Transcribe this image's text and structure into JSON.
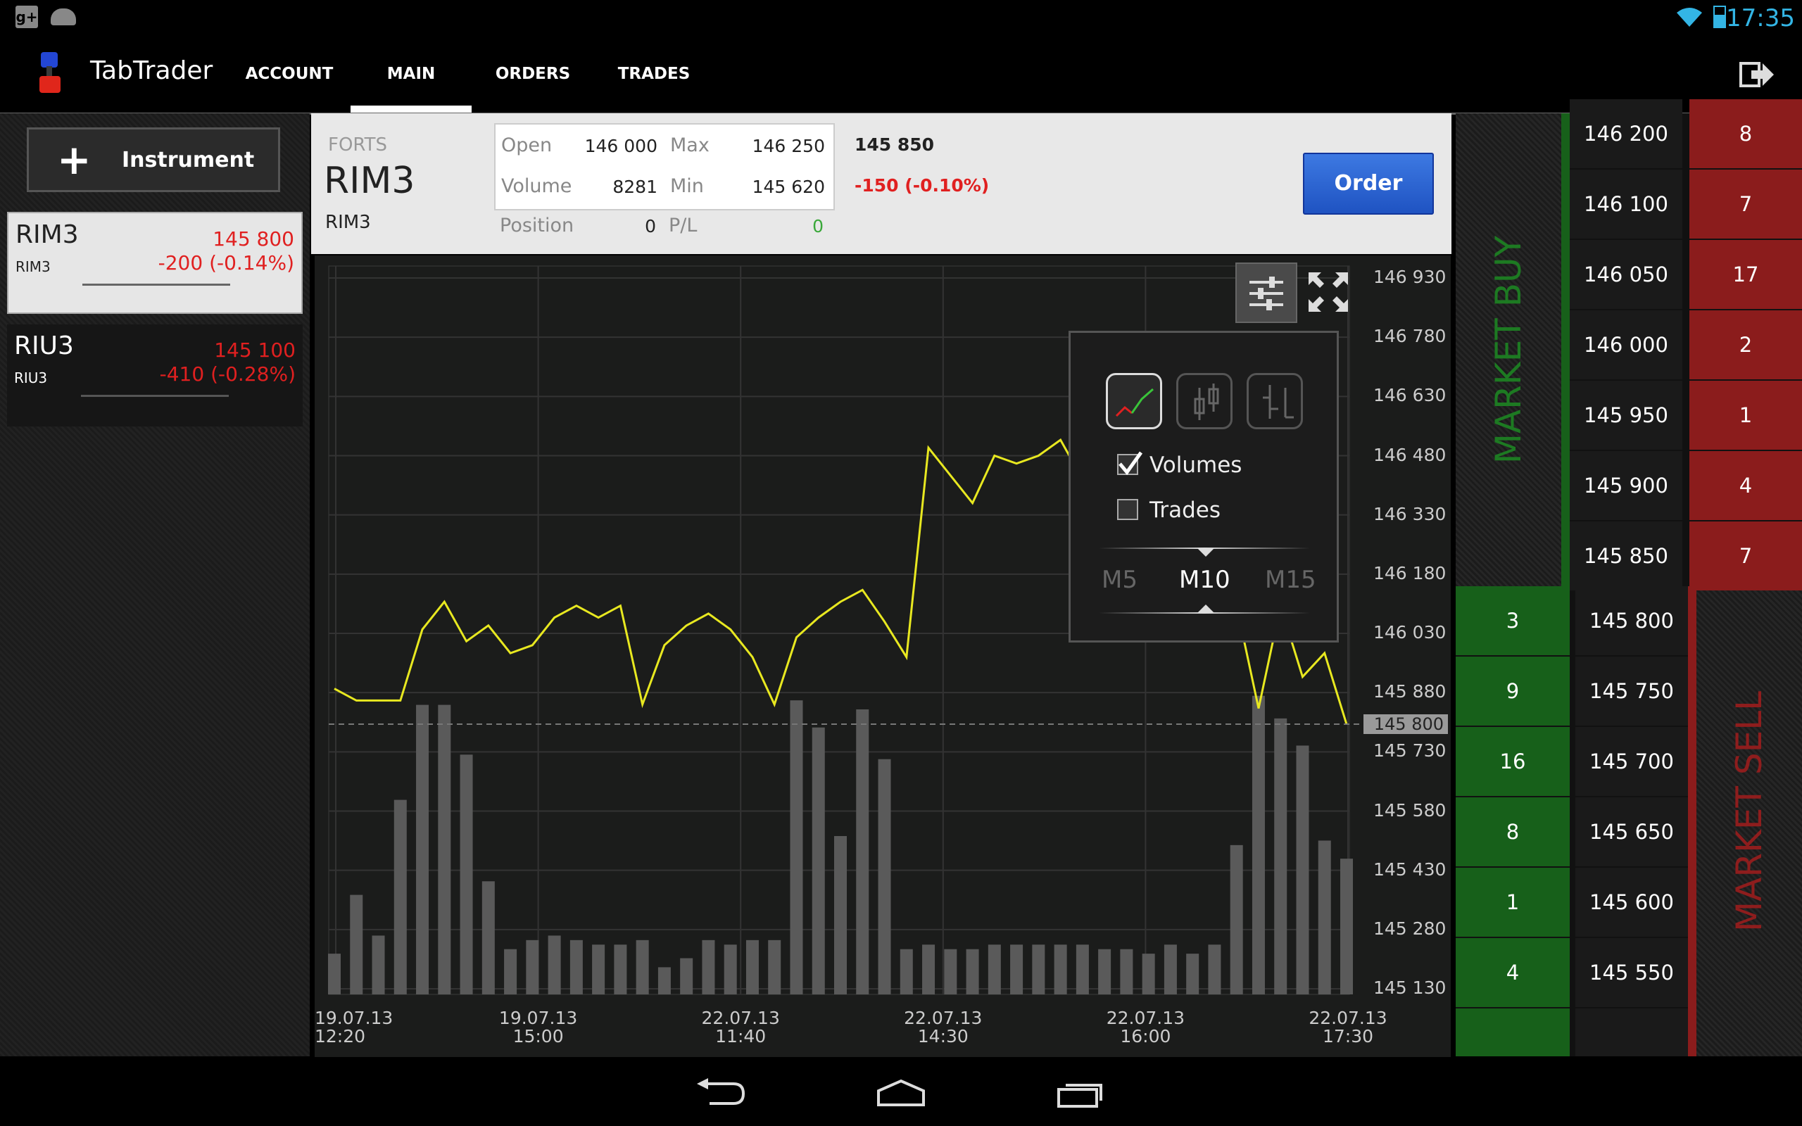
{
  "app": {
    "title": "TabTrader",
    "time": "17:35"
  },
  "tabs": [
    {
      "label": "ACCOUNT",
      "active": false
    },
    {
      "label": "MAIN",
      "active": true
    },
    {
      "label": "ORDERS",
      "active": false
    },
    {
      "label": "TRADES",
      "active": false
    }
  ],
  "sidebar": {
    "add_label": "Instrument",
    "instruments": [
      {
        "name": "RIM3",
        "sub": "RIM3",
        "price": "145 800",
        "change": "-200 (-0.14%)",
        "selected": true
      },
      {
        "name": "RIU3",
        "sub": "RIU3",
        "price": "145 100",
        "change": "-410 (-0.28%)",
        "selected": false
      }
    ]
  },
  "header": {
    "exchange": "FORTS",
    "symbol": "RIM3",
    "subsymbol": "RIM3",
    "stats": {
      "open_label": "Open",
      "open": "146 000",
      "max_label": "Max",
      "max": "146 250",
      "volume_label": "Volume",
      "volume": "8281",
      "min_label": "Min",
      "min": "145 620",
      "position_label": "Position",
      "position": "0",
      "pl_label": "P/L",
      "pl": "0"
    },
    "last_price": "145 850",
    "last_change": "-150 (-0.10%)",
    "order_label": "Order"
  },
  "chart_data": {
    "type": "line",
    "series": [
      {
        "values": [
          145890,
          145860,
          145860,
          145860,
          146040,
          146110,
          146010,
          146050,
          145980,
          146000,
          146070,
          146100,
          146070,
          146100,
          145850,
          146000,
          146050,
          146080,
          146040,
          145970,
          145850,
          146020,
          146070,
          146110,
          146140,
          146060,
          145970,
          146500,
          146430,
          146360,
          146480,
          146460,
          146480,
          146520,
          146420,
          146380,
          146520,
          146540,
          146490,
          146470,
          146430,
          146100,
          145840,
          146100,
          145920,
          145980,
          145800
        ]
      }
    ],
    "volume": [
      9,
      22,
      13,
      43,
      64,
      64,
      53,
      25,
      10,
      12,
      13,
      12,
      11,
      11,
      12,
      6,
      8,
      12,
      11,
      12,
      12,
      65,
      59,
      35,
      63,
      52,
      10,
      11,
      10,
      10,
      11,
      11,
      11,
      11,
      11,
      10,
      10,
      9,
      11,
      9,
      11,
      33,
      66,
      61,
      55,
      34,
      30
    ],
    "yticks": [
      "146 930",
      "146 780",
      "146 630",
      "146 480",
      "146 330",
      "146 180",
      "146 030",
      "145 880",
      "145 730",
      "145 580",
      "145 430",
      "145 280",
      "145 130"
    ],
    "xticks": [
      {
        "date": "19.07.13",
        "time": "12:20"
      },
      {
        "date": "19.07.13",
        "time": "15:00"
      },
      {
        "date": "22.07.13",
        "time": "11:40"
      },
      {
        "date": "22.07.13",
        "time": "14:30"
      },
      {
        "date": "22.07.13",
        "time": "16:00"
      },
      {
        "date": "22.07.13",
        "time": "17:30"
      }
    ],
    "ylim": [
      145130,
      146930
    ],
    "current_marker": "145 800",
    "line_color": "#e8e820",
    "bar_color": "#5a5a5a"
  },
  "popup": {
    "volumes_label": "Volumes",
    "volumes_checked": true,
    "trades_label": "Trades",
    "trades_checked": false,
    "intervals": [
      "M5",
      "M10",
      "M15"
    ],
    "selected_interval": "M10"
  },
  "orderbook": {
    "market_buy_label": "MARKET BUY",
    "market_sell_label": "MARKET SELL",
    "asks": [
      {
        "price": "146 200",
        "qty": "8"
      },
      {
        "price": "146 100",
        "qty": "7"
      },
      {
        "price": "146 050",
        "qty": "17"
      },
      {
        "price": "146 000",
        "qty": "2"
      },
      {
        "price": "145 950",
        "qty": "1"
      },
      {
        "price": "145 900",
        "qty": "4"
      },
      {
        "price": "145 850",
        "qty": "7"
      }
    ],
    "bids": [
      {
        "price": "145 800",
        "qty": "3"
      },
      {
        "price": "145 750",
        "qty": "9"
      },
      {
        "price": "145 700",
        "qty": "16"
      },
      {
        "price": "145 650",
        "qty": "8"
      },
      {
        "price": "145 600",
        "qty": "1"
      },
      {
        "price": "145 550",
        "qty": "4"
      }
    ],
    "buy_color": "#17601a",
    "sell_color": "#8b1c1c"
  }
}
